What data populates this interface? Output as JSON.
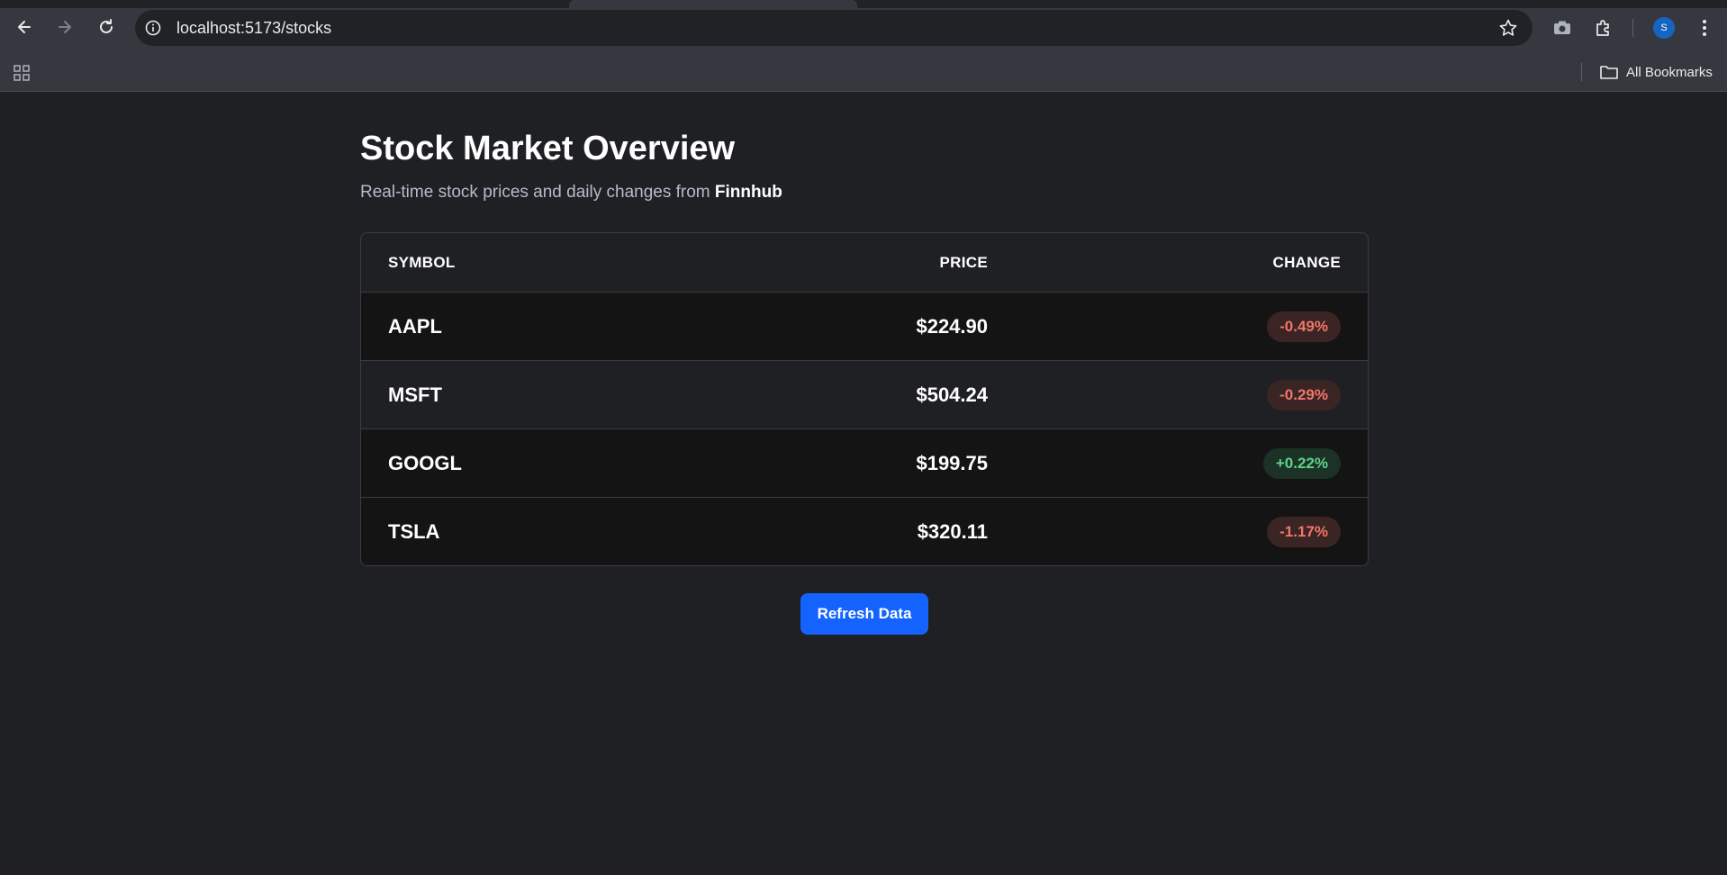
{
  "browser": {
    "url": "localhost:5173/stocks",
    "bookmarks_label": "All Bookmarks",
    "avatar_letter": "S",
    "icons": [
      "back-icon",
      "forward-icon",
      "reload-icon",
      "info-icon",
      "star-icon",
      "camera-icon",
      "extensions-icon",
      "menu-icon",
      "apps-grid-icon",
      "folder-icon"
    ]
  },
  "page": {
    "title": "Stock Market Overview",
    "subtitle_prefix": "Real-time stock prices and daily changes from",
    "subtitle_source": "Finnhub"
  },
  "table": {
    "headers": {
      "symbol": "SYMBOL",
      "price": "PRICE",
      "change": "CHANGE"
    },
    "rows": [
      {
        "symbol": "AAPL",
        "price": "$224.90",
        "change": "-0.49%",
        "direction": "down"
      },
      {
        "symbol": "MSFT",
        "price": "$504.24",
        "change": "-0.29%",
        "direction": "down"
      },
      {
        "symbol": "GOOGL",
        "price": "$199.75",
        "change": "+0.22%",
        "direction": "up"
      },
      {
        "symbol": "TSLA",
        "price": "$320.11",
        "change": "-1.17%",
        "direction": "down"
      }
    ]
  },
  "actions": {
    "refresh_label": "Refresh Data"
  },
  "colors": {
    "accent": "#1463ff",
    "negative": "#f0766a",
    "positive": "#5fd38a",
    "background": "#1f2023"
  }
}
